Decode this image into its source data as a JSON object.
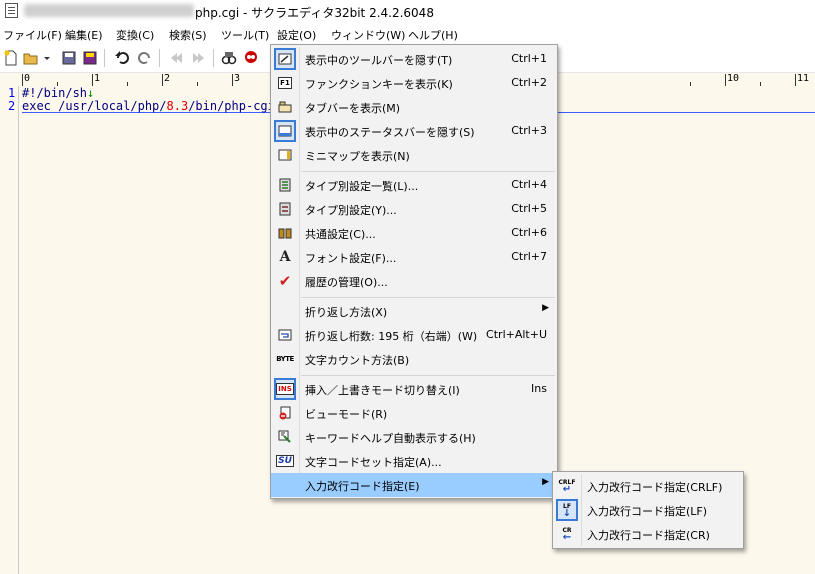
{
  "window": {
    "title_suffix": "php.cgi - サクラエディタ32bit 2.4.2.6048"
  },
  "menubar": [
    {
      "label": "ファイル(F)"
    },
    {
      "label": "編集(E)"
    },
    {
      "label": "変換(C)"
    },
    {
      "label": "検索(S)"
    },
    {
      "label": "ツール(T)"
    },
    {
      "label": "設定(O)"
    },
    {
      "label": "ウィンドウ(W)"
    },
    {
      "label": "ヘルプ(H)"
    }
  ],
  "ruler": {
    "labels": [
      "0",
      "1",
      "2",
      "3",
      "10",
      "11"
    ]
  },
  "editor": {
    "lines": [
      {
        "num": "1",
        "text": "#!/bin/sh",
        "eol": "↓"
      },
      {
        "num": "2",
        "pre": "exec /usr/local/php/",
        "hl": "8.3",
        "post": "/bin/php-cgi"
      }
    ]
  },
  "settings_menu": {
    "items": [
      {
        "label": "表示中のツールバーを隠す(T)",
        "shortcut": "Ctrl+1",
        "icon": "toolbar-icon"
      },
      {
        "label": "ファンクションキーを表示(K)",
        "shortcut": "Ctrl+2",
        "icon": "function-key-icon",
        "icon_text": "F1"
      },
      {
        "label": "タブバーを表示(M)",
        "shortcut": "",
        "icon": "tabbar-icon"
      },
      {
        "label": "表示中のステータスバーを隠す(S)",
        "shortcut": "Ctrl+3",
        "icon": "statusbar-icon"
      },
      {
        "label": "ミニマップを表示(N)",
        "shortcut": "",
        "icon": "minimap-icon"
      },
      {
        "label": "タイプ別設定一覧(L)...",
        "shortcut": "Ctrl+4",
        "icon": "type-list-icon"
      },
      {
        "label": "タイプ別設定(Y)...",
        "shortcut": "Ctrl+5",
        "icon": "type-settings-icon"
      },
      {
        "label": "共通設定(C)...",
        "shortcut": "Ctrl+6",
        "icon": "common-settings-icon"
      },
      {
        "label": "フォント設定(F)...",
        "shortcut": "Ctrl+7",
        "icon": "font-icon",
        "icon_text": "A"
      },
      {
        "label": "履歴の管理(O)...",
        "shortcut": "",
        "icon": "checkmark-icon",
        "icon_text": "✔"
      },
      {
        "label": "折り返し方法(X)",
        "shortcut": "",
        "icon": ""
      },
      {
        "label": "折り返し桁数: 195 桁（右端）(W)",
        "shortcut": "Ctrl+Alt+U",
        "icon": "wrap-icon"
      },
      {
        "label": "文字カウント方法(B)",
        "shortcut": "",
        "icon": "byte-icon",
        "icon_text": "BYTE"
      },
      {
        "label": "挿入／上書きモード切り替え(I)",
        "shortcut": "Ins",
        "icon": "insert-mode-icon",
        "icon_text": "INS"
      },
      {
        "label": "ビューモード(R)",
        "shortcut": "",
        "icon": "view-mode-icon"
      },
      {
        "label": "キーワードヘルプ自動表示する(H)",
        "shortcut": "",
        "icon": "keyword-help-icon"
      },
      {
        "label": "文字コードセット指定(A)...",
        "shortcut": "",
        "icon": "charset-icon",
        "icon_text": "SU"
      },
      {
        "label": "入力改行コード指定(E)",
        "shortcut": "",
        "icon": ""
      }
    ],
    "submenu_arrow": "▶"
  },
  "newline_submenu": {
    "items": [
      {
        "label": "入力改行コード指定(CRLF)",
        "icon": "crlf-icon",
        "icon_text": "CRLF"
      },
      {
        "label": "入力改行コード指定(LF)",
        "icon": "lf-icon",
        "icon_text": "LF"
      },
      {
        "label": "入力改行コード指定(CR)",
        "icon": "cr-icon",
        "icon_text": "CR"
      }
    ]
  },
  "colors": {
    "highlight": "#99ccff",
    "editor_bg": "#fdf8ec",
    "line_number": "#0000ff"
  }
}
